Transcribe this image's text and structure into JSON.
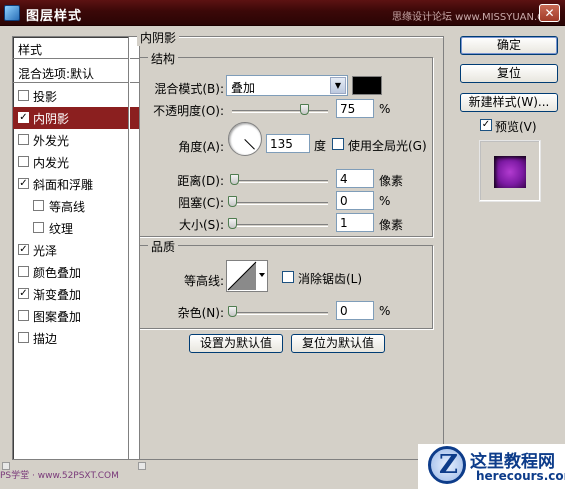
{
  "window": {
    "title": "图层样式",
    "watermark": "思缘设计论坛  www.MISSYUAN.COM",
    "close_glyph": "✕"
  },
  "left_panel": {
    "header": "样式",
    "blend_options": "混合选项:默认",
    "items": [
      {
        "label": "投影",
        "checked": false,
        "indent": false,
        "selected": false
      },
      {
        "label": "内阴影",
        "checked": true,
        "indent": false,
        "selected": true
      },
      {
        "label": "外发光",
        "checked": false,
        "indent": false,
        "selected": false
      },
      {
        "label": "内发光",
        "checked": false,
        "indent": false,
        "selected": false
      },
      {
        "label": "斜面和浮雕",
        "checked": true,
        "indent": false,
        "selected": false
      },
      {
        "label": "等高线",
        "checked": false,
        "indent": true,
        "selected": false
      },
      {
        "label": "纹理",
        "checked": false,
        "indent": true,
        "selected": false
      },
      {
        "label": "光泽",
        "checked": true,
        "indent": false,
        "selected": false
      },
      {
        "label": "颜色叠加",
        "checked": false,
        "indent": false,
        "selected": false
      },
      {
        "label": "渐变叠加",
        "checked": true,
        "indent": false,
        "selected": false
      },
      {
        "label": "图案叠加",
        "checked": false,
        "indent": false,
        "selected": false
      },
      {
        "label": "描边",
        "checked": false,
        "indent": false,
        "selected": false
      }
    ]
  },
  "main": {
    "section_title": "内阴影",
    "structure": {
      "title": "结构",
      "blend_mode_label": "混合模式(B):",
      "blend_mode_value": "叠加",
      "shadow_color": "#000000",
      "opacity_label": "不透明度(O):",
      "opacity_value": "75",
      "opacity_unit": "%",
      "opacity_level": 0.75,
      "angle_label": "角度(A):",
      "angle_value": "135",
      "angle_unit": "度",
      "global_light_label": "使用全局光(G)",
      "global_light_checked": false,
      "distance_label": "距离(D):",
      "distance_value": "4",
      "distance_unit": "像素",
      "choke_label": "阻塞(C):",
      "choke_value": "0",
      "choke_unit": "%",
      "size_label": "大小(S):",
      "size_value": "1",
      "size_unit": "像素"
    },
    "quality": {
      "title": "品质",
      "contour_label": "等高线:",
      "antialias_label": "消除锯齿(L)",
      "antialias_checked": false,
      "noise_label": "杂色(N):",
      "noise_value": "0",
      "noise_unit": "%"
    },
    "set_default_button": "设置为默认值",
    "reset_default_button": "复位为默认值"
  },
  "right_panel": {
    "ok_button": "确定",
    "reset_button": "复位",
    "new_style_button": "新建样式(W)...",
    "preview_label": "预览(V)",
    "preview_checked": true
  },
  "branding": {
    "site_cn": "这里教程网",
    "site_en": "herecours.com",
    "logo_letter": "Z",
    "bottom_watermark": "PS学堂 · www.52PSXT.COM"
  }
}
